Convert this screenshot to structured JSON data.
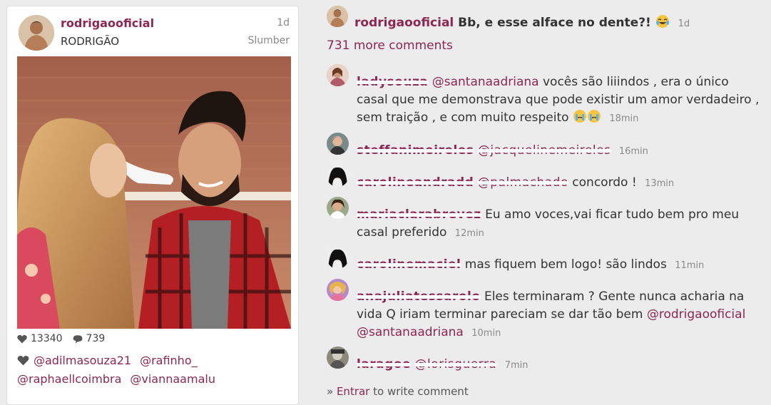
{
  "post": {
    "username": "rodrigaooficial",
    "display_name": "RODRIGÃO",
    "time": "1d",
    "filter": "Slumber",
    "likes": "13340",
    "comments_count": "739",
    "likers": [
      "@adilmasouza21",
      "@rafinho_",
      "@raphaellcoimbra",
      "@viannaamalu"
    ],
    "colors": {
      "accent": "#8b2750",
      "muted": "#8a8a8a"
    }
  },
  "caption": {
    "username": "rodrigaooficial",
    "text": "Bb, e esse alface no dente?!",
    "emoji": "crying-laughing-emoji",
    "time": "1d"
  },
  "more_comments": "731 more comments",
  "comments": [
    {
      "username": "ladysouza",
      "mention": "@santanaadriana",
      "text": "vocês são liiindos , era o único casal que me demonstrava que pode existir um amor verdadeiro , sem traição , e com muito respeito",
      "emoji": "crying-emoji",
      "time": "18min"
    },
    {
      "username": "steffanimeireles",
      "mention": "@jacquelinemeireles",
      "text": "",
      "time": "16min"
    },
    {
      "username": "carolineandradd",
      "mention": "@palmachado",
      "text": "concordo !",
      "time": "13min"
    },
    {
      "username": "mariaclarabrevez",
      "mention": "",
      "text": "Eu amo voces,vai ficar tudo bem pro meu casal preferido",
      "time": "12min"
    },
    {
      "username": "carolinemaciel",
      "mention": "",
      "text": "mas fiquem bem logo! são lindos",
      "time": "11min"
    },
    {
      "username": "anajuliatessarolo",
      "mention": "",
      "text": "Eles terminaram ? Gente nunca acharia na vida Q iriam terminar pareciam se dar tão bem",
      "mention2": "@rodrigaooficial",
      "mention3": "@santanaadriana",
      "time": "10min"
    },
    {
      "username": "laragoe",
      "mention": "@lorisguerra",
      "text": "",
      "time": "7min"
    }
  ],
  "login": {
    "prefix": "» ",
    "link": "Entrar",
    "suffix": " to write comment"
  }
}
